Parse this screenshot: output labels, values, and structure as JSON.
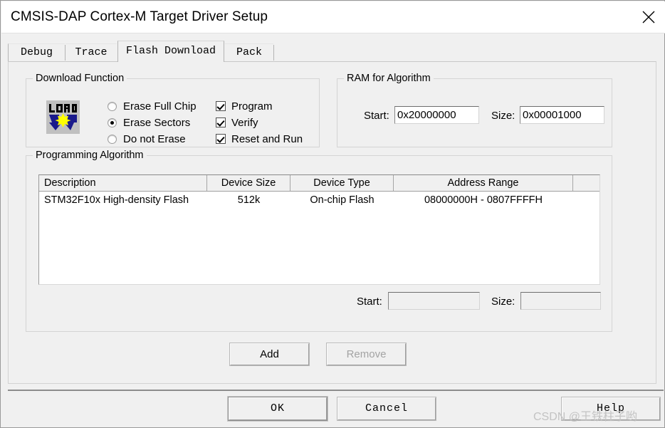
{
  "window": {
    "title": "CMSIS-DAP Cortex-M Target Driver Setup",
    "close_icon": "close-icon"
  },
  "tabs": [
    {
      "label": "Debug",
      "selected": false
    },
    {
      "label": "Trace",
      "selected": false
    },
    {
      "label": "Flash Download",
      "selected": true
    },
    {
      "label": "Pack",
      "selected": false
    }
  ],
  "download_function": {
    "title": "Download Function",
    "icon_label": "LOAD",
    "erase_options": [
      {
        "label": "Erase Full Chip",
        "checked": false
      },
      {
        "label": "Erase Sectors",
        "checked": true
      },
      {
        "label": "Do not Erase",
        "checked": false
      }
    ],
    "checkboxes": [
      {
        "label": "Program",
        "checked": true
      },
      {
        "label": "Verify",
        "checked": true
      },
      {
        "label": "Reset and Run",
        "checked": true
      }
    ]
  },
  "ram_for_algorithm": {
    "title": "RAM for Algorithm",
    "start_label": "Start:",
    "start_value": "0x20000000",
    "size_label": "Size:",
    "size_value": "0x00001000"
  },
  "programming_algorithm": {
    "title": "Programming Algorithm",
    "columns": [
      "Description",
      "Device Size",
      "Device Type",
      "Address Range",
      ""
    ],
    "rows": [
      {
        "description": "STM32F10x High-density Flash",
        "device_size": "512k",
        "device_type": "On-chip Flash",
        "address_range": "08000000H - 0807FFFFH"
      }
    ],
    "start_label": "Start:",
    "start_value": "",
    "size_label": "Size:",
    "size_value": "",
    "add_button": "Add",
    "remove_button": "Remove"
  },
  "footer": {
    "ok_button": "OK",
    "cancel_button": "Cancel",
    "help_button": "Help"
  },
  "watermark": "CSDN @王铁柱子哟",
  "colors": {
    "dialog_bg": "#f0f0f0",
    "titlebar_bg": "#ffffff",
    "field_bg": "#ffffff",
    "icon_blue": "#1a1a8c",
    "icon_yellow": "#ffff00",
    "disabled_text": "#a3a3a3"
  }
}
